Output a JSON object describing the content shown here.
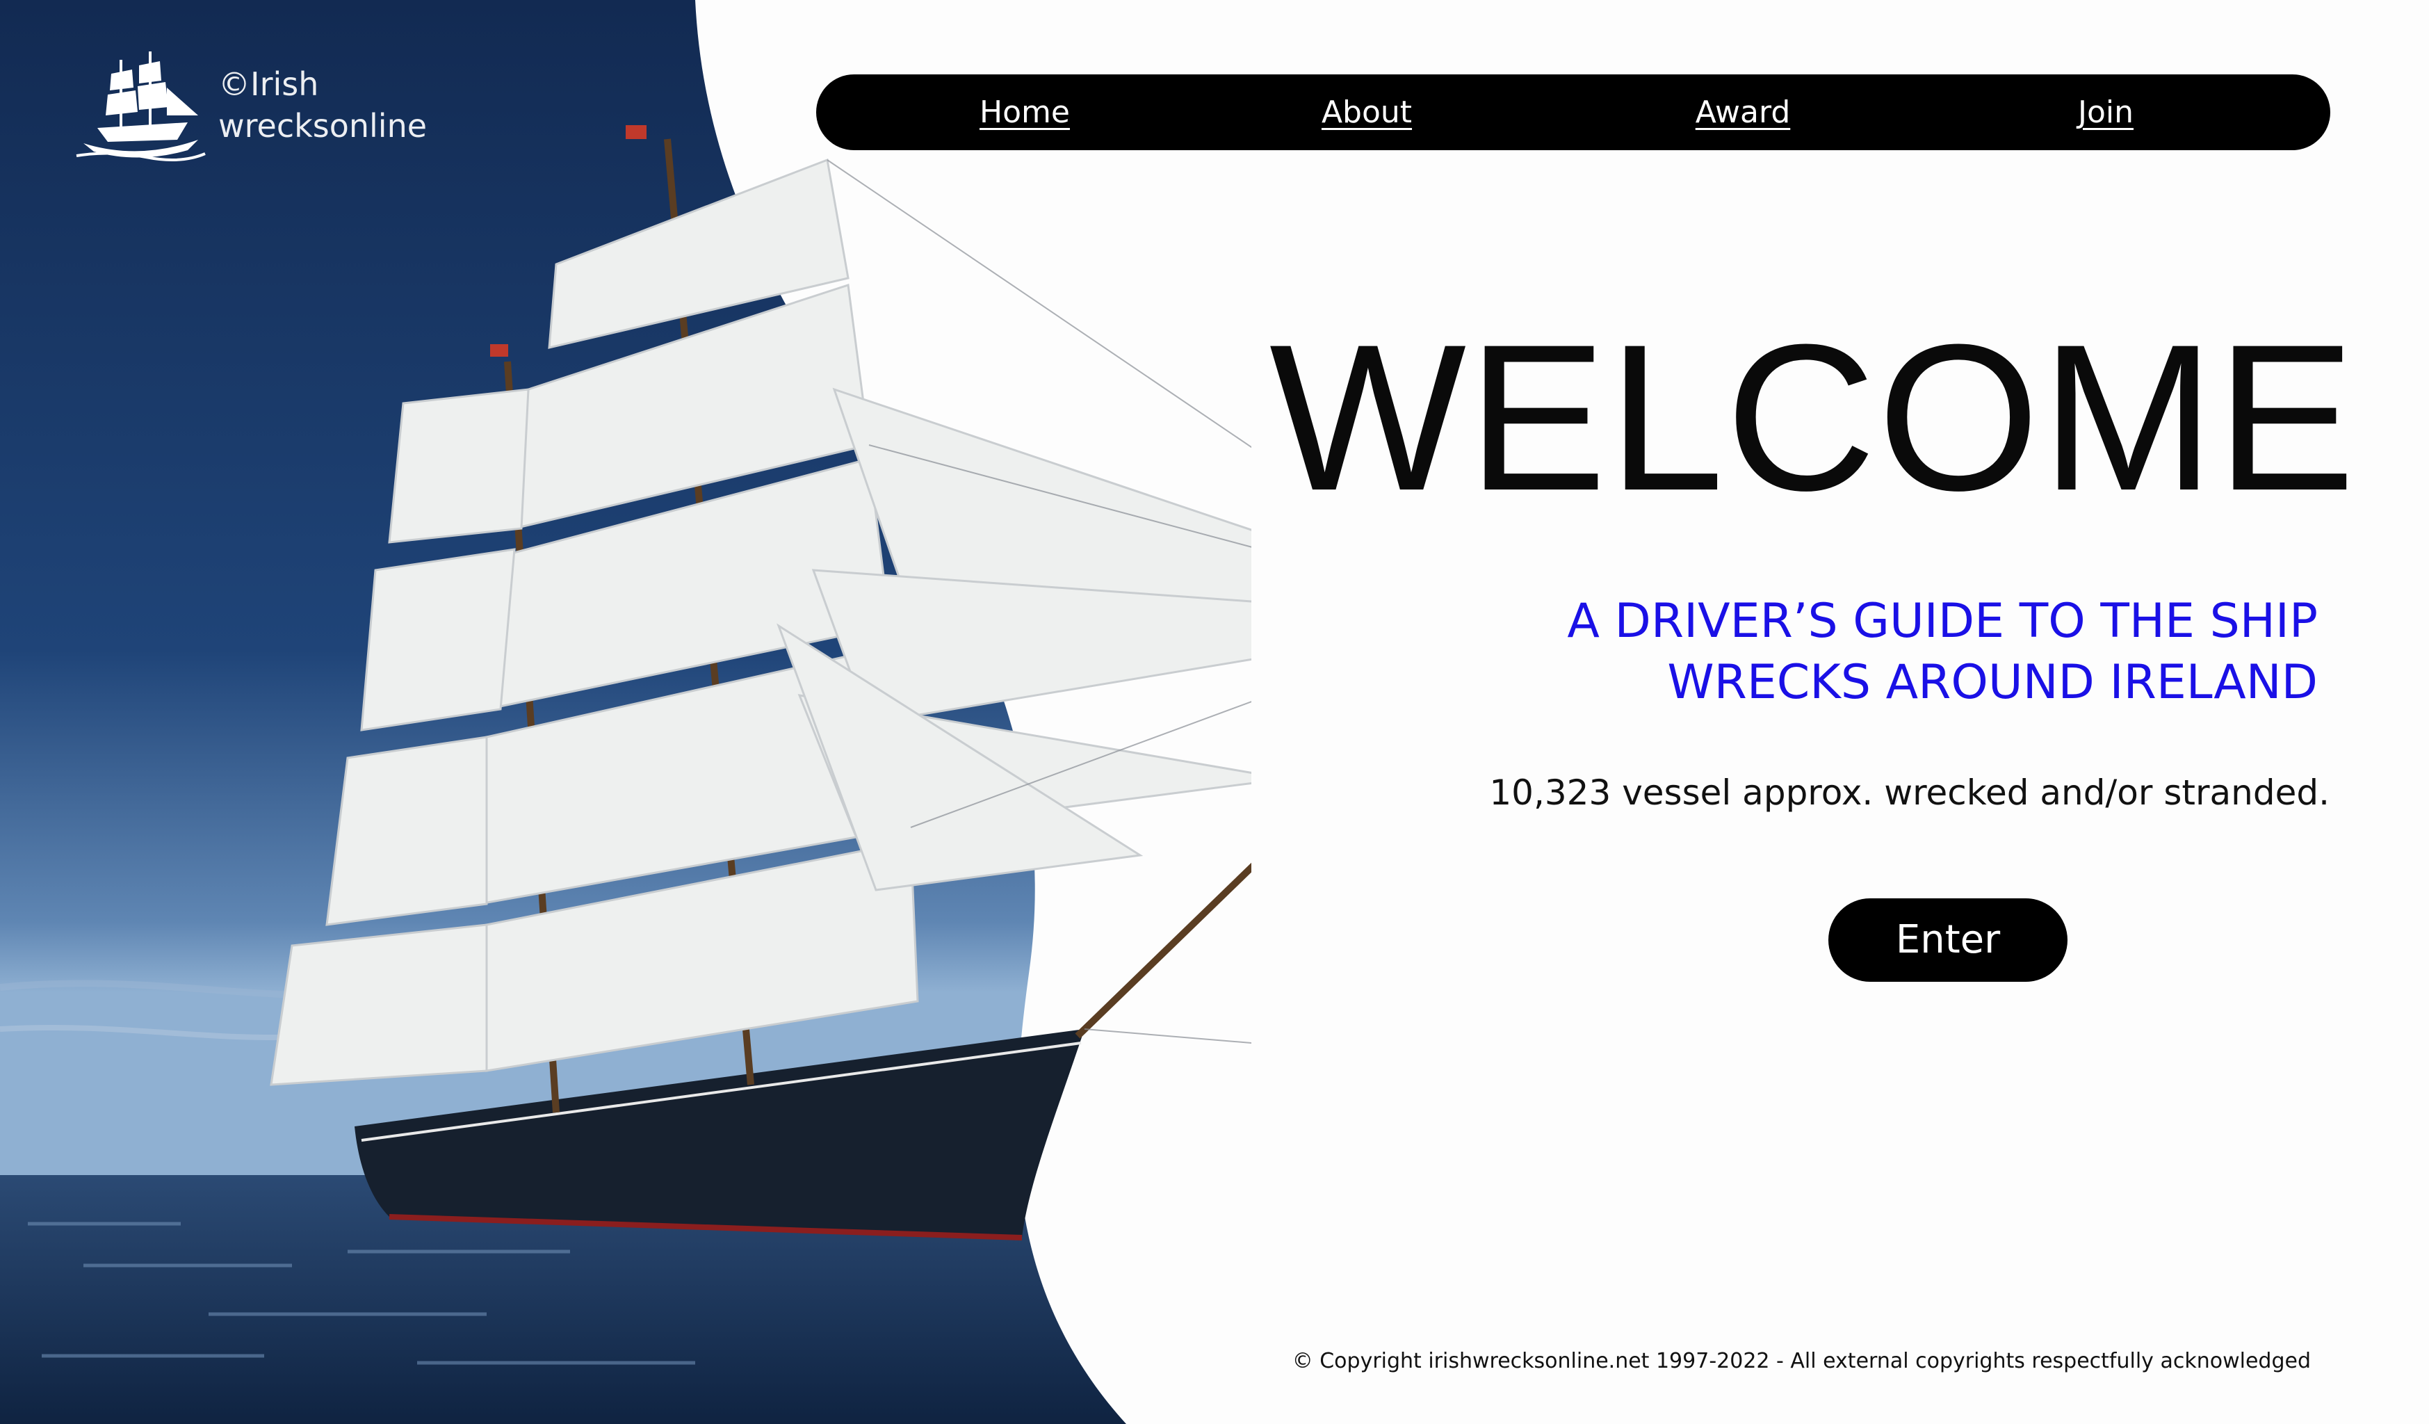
{
  "logo": {
    "line1": "©Irish",
    "line2": "wrecksonline",
    "icon": "sailing-ship-icon"
  },
  "nav": {
    "items": [
      {
        "label": "Home"
      },
      {
        "label": "About"
      },
      {
        "label": "Award"
      },
      {
        "label": "Join"
      }
    ]
  },
  "hero": {
    "image": "tall-ship-photo",
    "heading": "WELCOME",
    "subtitle_line1": "A DRIVER’S GUIDE TO THE SHIP",
    "subtitle_line2": "WRECKS AROUND IRELAND",
    "count_text": "10,323 vessel approx. wrecked and/or stranded.",
    "enter_label": "Enter"
  },
  "footer": {
    "copyright": "© Copyright irishwrecksonline.net 1997-2022 - All external copyrights respectfully acknowledged"
  },
  "colors": {
    "accent": "#1a10e6",
    "nav_bg": "#000000",
    "sky": "#1a3566",
    "sea": "#1f3b63"
  }
}
